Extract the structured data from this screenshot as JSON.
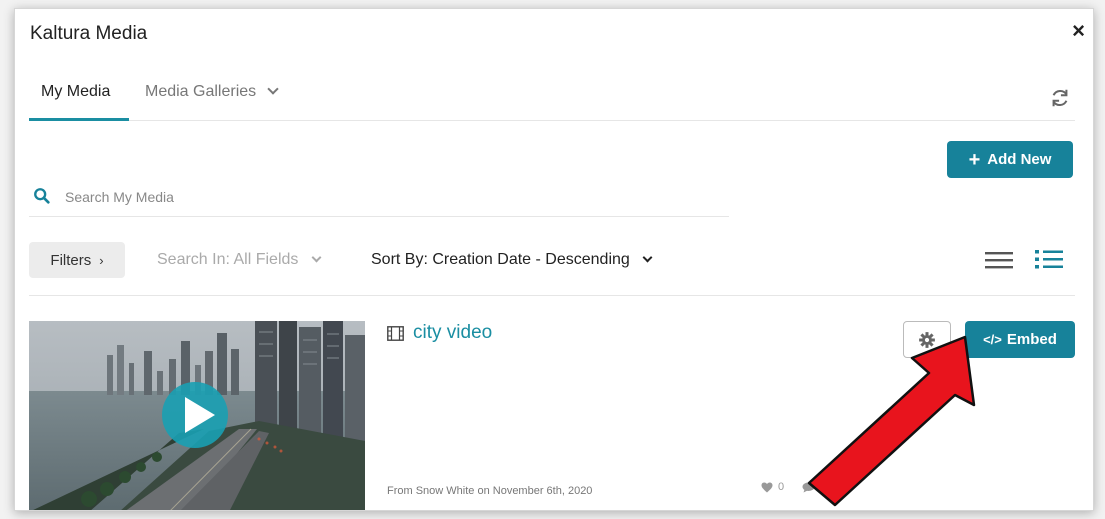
{
  "dialog": {
    "title": "Kaltura Media",
    "close_label": "×"
  },
  "tabs": [
    {
      "label": "My Media",
      "active": true
    },
    {
      "label": "Media Galleries",
      "active": false
    }
  ],
  "toolbar": {
    "add_new_label": "Add New",
    "search_placeholder": "Search My Media",
    "filters_label": "Filters",
    "search_in_label": "Search In: All Fields",
    "sort_by_label": "Sort By: Creation Date - Descending"
  },
  "media_items": [
    {
      "title": "city video",
      "meta": "From Snow White on November 6th, 2020",
      "likes": "0",
      "comments": "0",
      "embed_label": "Embed"
    }
  ],
  "colors": {
    "accent": "#17829a",
    "callout_arrow": "#e8141d"
  },
  "icons": [
    "close-icon",
    "chevron-down-icon",
    "refresh-icon",
    "plus-icon",
    "search-icon",
    "chevron-right-icon",
    "list-view-icon",
    "detail-view-icon",
    "film-icon",
    "gear-icon",
    "code-icon",
    "heart-icon",
    "comment-icon",
    "play-icon",
    "callout-arrow"
  ]
}
